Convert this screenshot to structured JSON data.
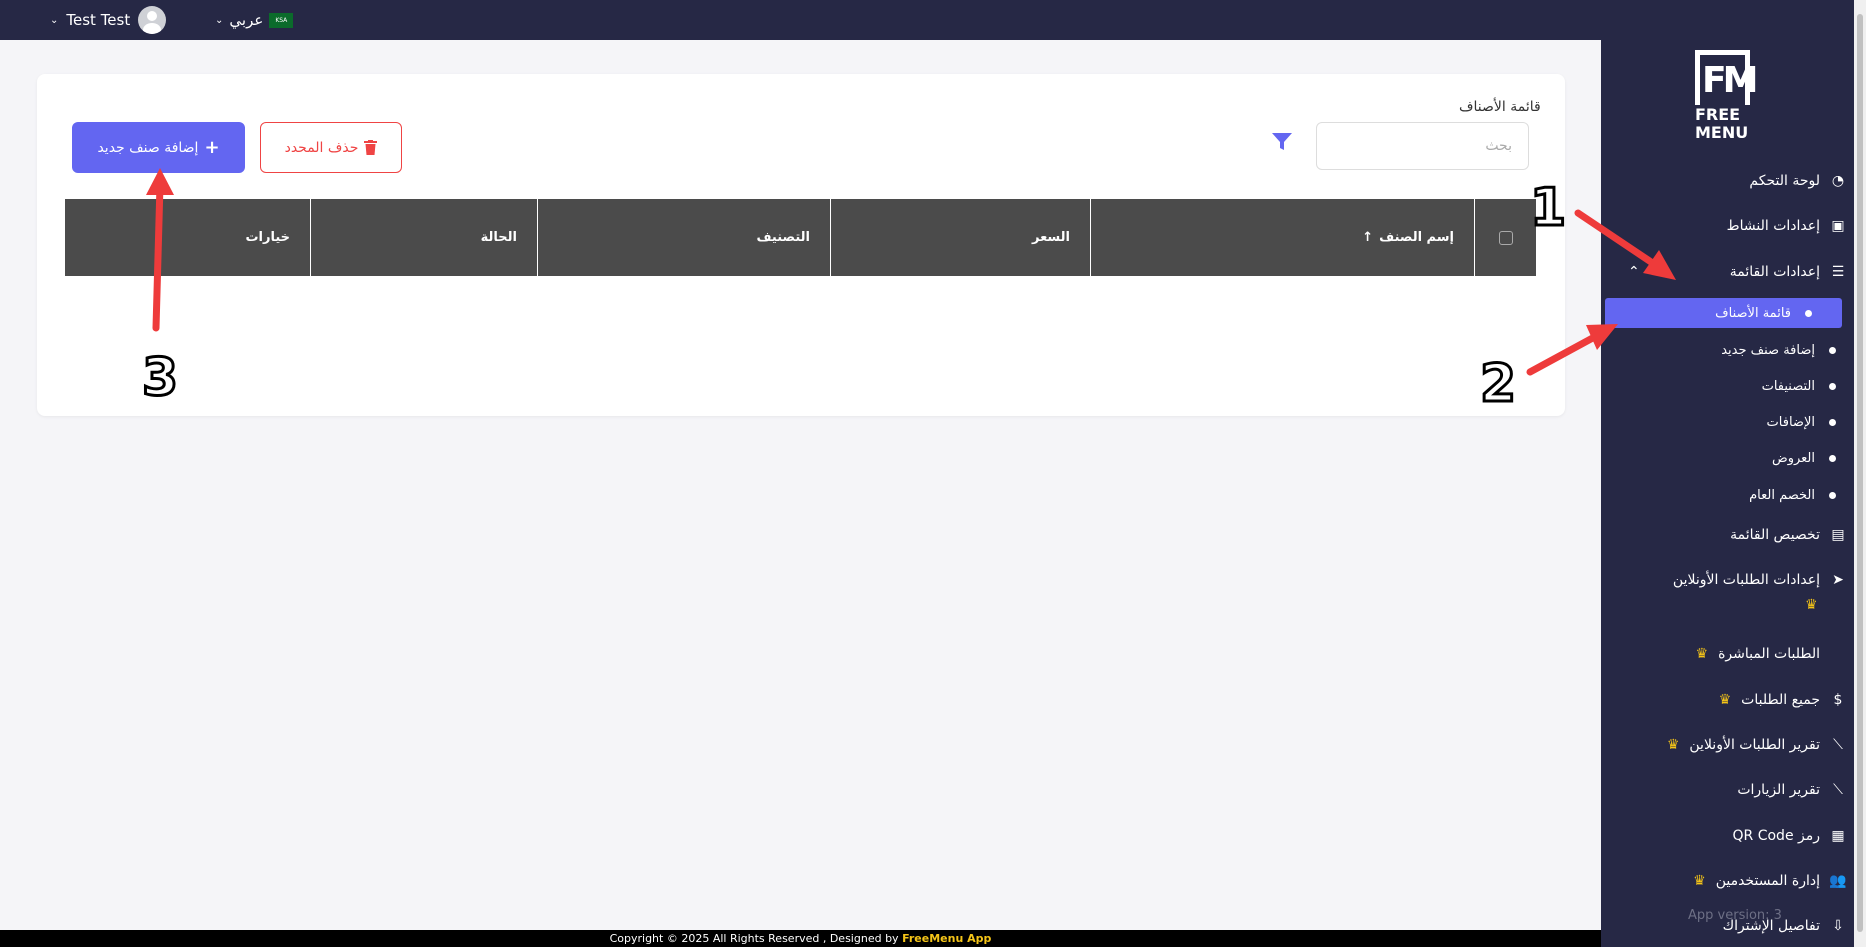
{
  "topbar": {
    "user_name": "Test Test",
    "language": "عربي",
    "flag_text": "KSA"
  },
  "sidebar": {
    "logo_text_1": "FREE",
    "logo_text_2": "MENU",
    "items": [
      {
        "label": "لوحة التحكم",
        "icon": "dashboard-icon"
      },
      {
        "label": "إعدادات النشاط",
        "icon": "briefcase-icon"
      },
      {
        "label": "إعدادات القائمة",
        "icon": "burger-icon"
      }
    ],
    "sub_items": [
      {
        "label": "قائمة الأصناف",
        "active": true
      },
      {
        "label": "إضافة صنف جديد"
      },
      {
        "label": "التصنيفات"
      },
      {
        "label": "الإضافات"
      },
      {
        "label": "العروض"
      },
      {
        "label": "الخصم العام"
      }
    ],
    "items_after": [
      {
        "label": "تخصيص القائمة",
        "icon": "images-icon"
      },
      {
        "label": "إعدادات الطلبات الأونلاين",
        "icon": "telegram-icon",
        "crown": true
      },
      {
        "label": "الطلبات المباشرة",
        "icon": "none",
        "crown": true
      },
      {
        "label": "جميع الطلبات",
        "icon": "money-bag-icon",
        "crown": true
      },
      {
        "label": "تقرير الطلبات الأونلاين",
        "icon": "chart-line-icon",
        "crown": true
      },
      {
        "label": "تقرير الزيارات",
        "icon": "chart-line-icon"
      },
      {
        "label": "رمز QR Code",
        "icon": "qrcode-icon"
      },
      {
        "label": "إدارة المستخدمين",
        "icon": "users-icon",
        "crown": true
      },
      {
        "label": "تفاصيل الإشتراك",
        "icon": "hand-coin-icon"
      }
    ],
    "version": "App version: 3"
  },
  "main": {
    "title": "قائمة الأصناف",
    "search_placeholder": "بحث",
    "delete_button": "حذف المحدد",
    "add_button": "إضافة صنف جديد",
    "columns": [
      "إسم الصنف",
      "السعر",
      "التصنيف",
      "الحالة",
      "خيارات"
    ]
  },
  "footer": {
    "text": "Copyright © 2025 All Rights Reserved , Designed by",
    "brand": "FreeMenu App"
  },
  "annotations": [
    "1",
    "2",
    "3"
  ],
  "colors": {
    "sidebar_bg": "#262845",
    "accent": "#6366f1",
    "danger": "#ef4444",
    "crown": "#f5c518",
    "arrow": "#ee3b3b"
  }
}
